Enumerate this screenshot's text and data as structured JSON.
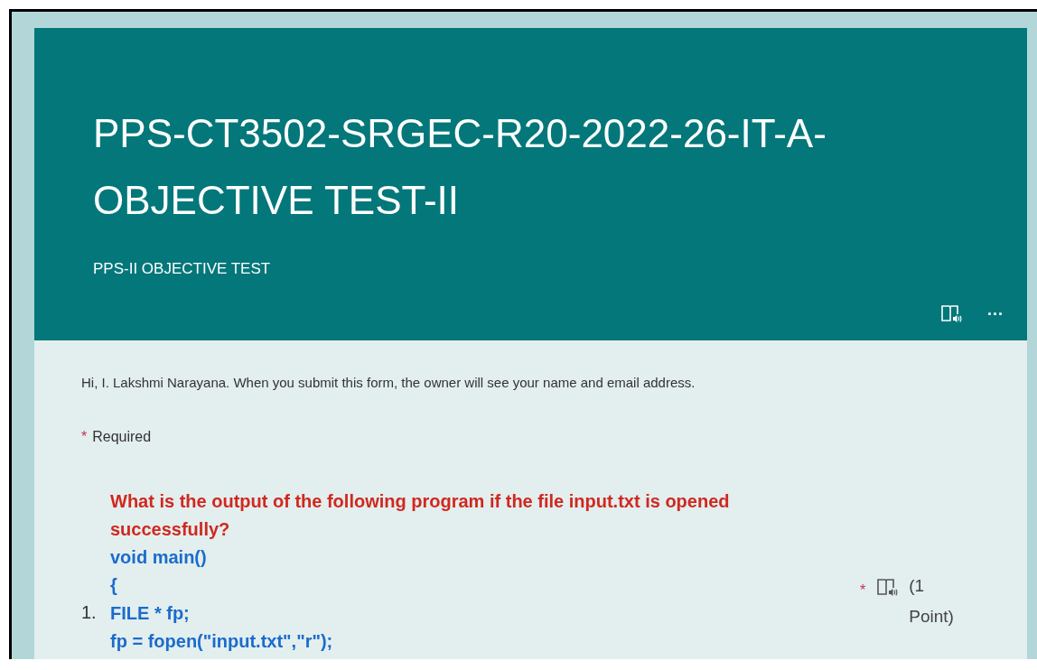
{
  "form": {
    "title": "PPS-CT3502-SRGEC-R20-2022-26-IT-A-OBJECTIVE TEST-II",
    "subtitle": "PPS-II OBJECTIVE TEST",
    "more_menu": "···"
  },
  "notice": "Hi, I. Lakshmi Narayana. When you submit this form, the owner will see your name and email address.",
  "required_note": {
    "mark": "*",
    "label": "Required"
  },
  "questions": [
    {
      "number": "1.",
      "prompt": "What is the output of the following program if the file input.txt is opened successfully?",
      "code_lines": [
        "void main()",
        "{",
        "FILE * fp;",
        "fp = fopen(\"input.txt\",\"r\");"
      ],
      "required": true,
      "required_mark": "*",
      "points": "(1 Point)"
    }
  ]
}
